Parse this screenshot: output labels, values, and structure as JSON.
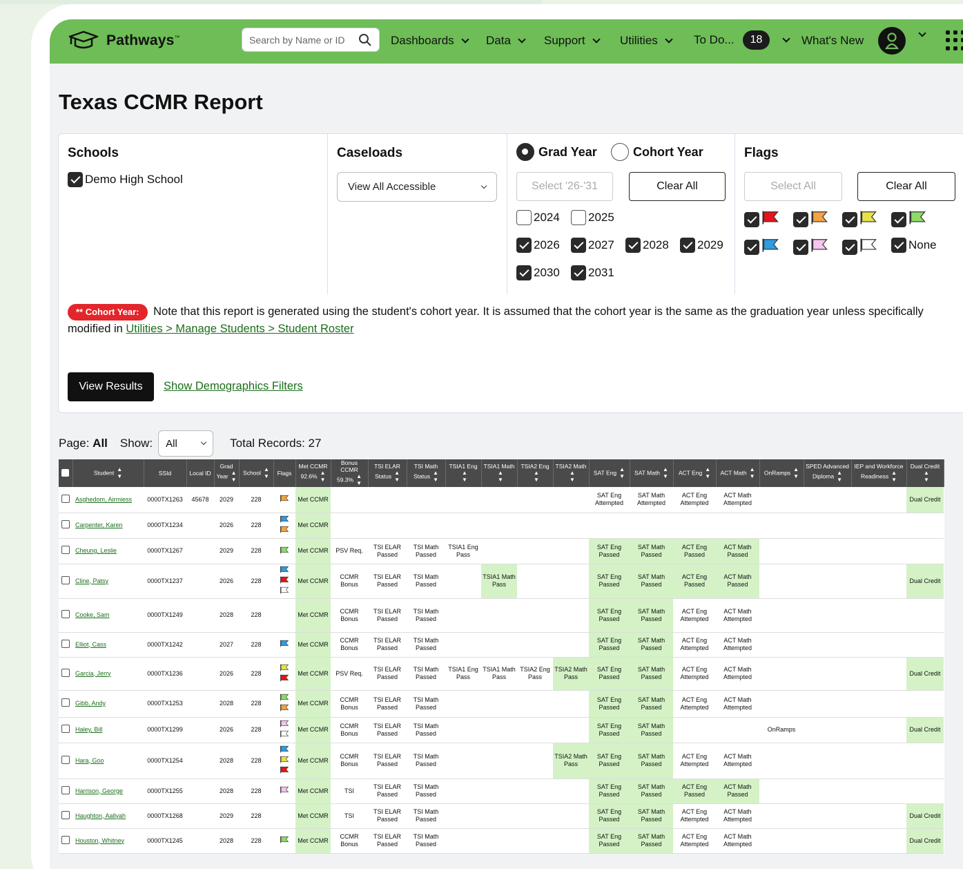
{
  "app": {
    "name": "Pathways",
    "trademark": "™"
  },
  "nav": {
    "search_placeholder": "Search by Name or ID",
    "items": [
      "Dashboards",
      "Data",
      "Support",
      "Utilities"
    ],
    "todo_label": "To Do...",
    "todo_count": "18",
    "whats_new": "What's New"
  },
  "page": {
    "title": "Texas CCMR Report"
  },
  "filters": {
    "schools": {
      "title": "Schools",
      "items": [
        {
          "label": "Demo High School",
          "checked": true
        }
      ]
    },
    "caseloads": {
      "title": "Caseloads",
      "selected": "View All Accessible"
    },
    "year": {
      "grad_label": "Grad Year",
      "cohort_label": "Cohort Year",
      "selected": "Grad Year",
      "select_btn": "Select '26-'31",
      "clear_btn": "Clear All",
      "years": [
        {
          "label": "2024",
          "checked": false
        },
        {
          "label": "2025",
          "checked": false
        },
        {
          "label": "2026",
          "checked": true
        },
        {
          "label": "2027",
          "checked": true
        },
        {
          "label": "2028",
          "checked": true
        },
        {
          "label": "2029",
          "checked": true
        },
        {
          "label": "2030",
          "checked": true
        },
        {
          "label": "2031",
          "checked": true
        }
      ]
    },
    "flags": {
      "title": "Flags",
      "select_btn": "Select All",
      "clear_btn": "Clear All",
      "none_label": "None",
      "colors": [
        "#e8141b",
        "#f4a340",
        "#e8e04a",
        "#8edb6a",
        "#2f9be0",
        "#f5c6ee",
        "#ffffff"
      ]
    }
  },
  "note": {
    "pill": "** Cohort Year:",
    "text": "Note that this report is generated using the student's cohort year. It is assumed that the cohort year is the same as the graduation year unless specifically modified in",
    "link": "Utilities > Manage Students > Student Roster"
  },
  "actions": {
    "view_results": "View Results",
    "show_demographics": "Show Demographics Filters"
  },
  "pager": {
    "page_label": "Page:",
    "page_value": "All",
    "show_label": "Show:",
    "show_value": "All",
    "total_label": "Total Records: 27"
  },
  "table": {
    "headers": [
      "Student",
      "SSId",
      "Local ID",
      "Grad Year",
      "School",
      "Flags",
      "Met CCMR 92.6%",
      "Bonus CCMR 59.3%",
      "TSI ELAR Status",
      "TSI Math Status",
      "TSIA1 Eng",
      "TSIA1 Math",
      "TSIA2 Eng",
      "TSIA2 Math",
      "SAT Eng",
      "SAT Math",
      "ACT Eng",
      "ACT Math",
      "OnRamps",
      "SPED Advanced Diploma",
      "IEP and Workforce Readiness",
      "Dual Credit"
    ],
    "rows": [
      {
        "name": "Asghedom, Airmiess",
        "ssid": "0000TX1263",
        "local": "45678",
        "grad": "2029",
        "school": "228",
        "flags": [
          "#f4a340"
        ],
        "met": "Met CCMR",
        "bonus": "",
        "elar": "",
        "math": "",
        "a1e": "",
        "a1m": "",
        "a2e": "",
        "a2m": "",
        "sate": "SAT Eng Attempted",
        "satm": "SAT Math Attempted",
        "acte": "ACT Eng Attempted",
        "actm": "ACT Math Attempted",
        "onr": "",
        "sped": "",
        "iep": "",
        "dual": "Dual Credit",
        "h": 37
      },
      {
        "name": "Carpenter, Karen",
        "ssid": "0000TX1234",
        "local": "",
        "grad": "2026",
        "school": "228",
        "flags": [
          "#2f9be0",
          "#f4a340"
        ],
        "met": "Met CCMR",
        "bonus": "",
        "elar": "",
        "math": "",
        "a1e": "",
        "a1m": "",
        "a2e": "",
        "a2m": "",
        "sate": "",
        "satm": "",
        "acte": "",
        "actm": "",
        "onr": "",
        "sped": "",
        "iep": "",
        "dual": "",
        "h": 37
      },
      {
        "name": "Cheung, Leslie",
        "ssid": "0000TX1267",
        "local": "",
        "grad": "2029",
        "school": "228",
        "flags": [
          "#8edb6a"
        ],
        "met": "Met CCMR",
        "bonus": "PSV Req.",
        "elar": "TSI ELAR Passed",
        "math": "TSI Math Passed",
        "a1e": "TSIA1 Eng Pass",
        "a1m": "",
        "a2e": "",
        "a2m": "",
        "sate": "SAT Eng Passed",
        "satm": "SAT Math Passed",
        "acte": "ACT Eng Passed",
        "actm": "ACT Math Passed",
        "onr": "",
        "sped": "",
        "iep": "",
        "dual": "",
        "h": 37
      },
      {
        "name": "Cline, Patsy",
        "ssid": "0000TX1237",
        "local": "",
        "grad": "2026",
        "school": "228",
        "flags": [
          "#2f9be0",
          "#e8141b",
          "#ffffff"
        ],
        "met": "Met CCMR",
        "bonus": "CCMR Bonus",
        "elar": "TSI ELAR Passed",
        "math": "TSI Math Passed",
        "a1e": "",
        "a1m": "TSIA1 Math Pass",
        "a2e": "",
        "a2m": "",
        "sate": "SAT Eng Passed",
        "satm": "SAT Math Passed",
        "acte": "ACT Eng Passed",
        "actm": "ACT Math Passed",
        "onr": "",
        "sped": "",
        "iep": "",
        "dual": "Dual Credit",
        "h": 50
      },
      {
        "name": "Cooke, Sam",
        "ssid": "0000TX1249",
        "local": "",
        "grad": "2028",
        "school": "228",
        "flags": [],
        "met": "Met CCMR",
        "bonus": "CCMR Bonus",
        "elar": "TSI ELAR Passed",
        "math": "TSI Math Passed",
        "a1e": "",
        "a1m": "",
        "a2e": "",
        "a2m": "",
        "sate": "SAT Eng Passed",
        "satm": "SAT Math Passed",
        "acte": "ACT Eng Attempted",
        "actm": "ACT Math Attempted",
        "onr": "",
        "sped": "",
        "iep": "",
        "dual": "",
        "h": 49
      },
      {
        "name": "Elliot, Cass",
        "ssid": "0000TX1242",
        "local": "",
        "grad": "2027",
        "school": "228",
        "flags": [
          "#2f9be0"
        ],
        "met": "Met CCMR",
        "bonus": "CCMR Bonus",
        "elar": "TSI ELAR Passed",
        "math": "TSI Math Passed",
        "a1e": "",
        "a1m": "",
        "a2e": "",
        "a2m": "",
        "sate": "SAT Eng Passed",
        "satm": "SAT Math Passed",
        "acte": "ACT Eng Attempted",
        "actm": "ACT Math Attempted",
        "onr": "",
        "sped": "",
        "iep": "",
        "dual": "",
        "h": 36
      },
      {
        "name": "Garcia, Jerry",
        "ssid": "0000TX1236",
        "local": "",
        "grad": "2026",
        "school": "228",
        "flags": [
          "#e8e04a",
          "#e8141b"
        ],
        "met": "Met CCMR",
        "bonus": "PSV Req.",
        "elar": "TSI ELAR Passed",
        "math": "TSI Math Passed",
        "a1e": "TSIA1 Eng Pass",
        "a1m": "TSIA1 Math Pass",
        "a2e": "TSIA2 Eng Pass",
        "a2m": "TSIA2 Math Pass",
        "sate": "SAT Eng Passed",
        "satm": "SAT Math Passed",
        "acte": "ACT Eng Attempted",
        "actm": "ACT Math Attempted",
        "onr": "",
        "sped": "",
        "iep": "",
        "dual": "Dual Credit",
        "h": 48
      },
      {
        "name": "Gibb, Andy",
        "ssid": "0000TX1253",
        "local": "",
        "grad": "2028",
        "school": "228",
        "flags": [
          "#8edb6a",
          "#f4a340"
        ],
        "met": "Met CCMR",
        "bonus": "CCMR Bonus",
        "elar": "TSI ELAR Passed",
        "math": "TSI Math Passed",
        "a1e": "",
        "a1m": "",
        "a2e": "",
        "a2m": "",
        "sate": "SAT Eng Passed",
        "satm": "SAT Math Passed",
        "acte": "ACT Eng Attempted",
        "actm": "ACT Math Attempted",
        "onr": "",
        "sped": "",
        "iep": "",
        "dual": "",
        "h": 39
      },
      {
        "name": "Haley, Bill",
        "ssid": "0000TX1299",
        "local": "",
        "grad": "2026",
        "school": "228",
        "flags": [
          "#f5c6ee",
          "#ffffff"
        ],
        "met": "Met CCMR",
        "bonus": "CCMR Bonus",
        "elar": "TSI ELAR Passed",
        "math": "TSI Math Passed",
        "a1e": "",
        "a1m": "",
        "a2e": "",
        "a2m": "",
        "sate": "SAT Eng Passed",
        "satm": "SAT Math Passed",
        "acte": "",
        "actm": "",
        "onr": "OnRamps",
        "sped": "",
        "iep": "",
        "dual": "Dual Credit",
        "h": 37
      },
      {
        "name": "Hara, Goo",
        "ssid": "0000TX1254",
        "local": "",
        "grad": "2028",
        "school": "228",
        "flags": [
          "#2f9be0",
          "#e8e04a",
          "#e8141b"
        ],
        "met": "Met CCMR",
        "bonus": "CCMR Bonus",
        "elar": "TSI ELAR Passed",
        "math": "TSI Math Passed",
        "a1e": "",
        "a1m": "",
        "a2e": "",
        "a2m": "TSIA2 Math Pass",
        "sate": "SAT Eng Passed",
        "satm": "SAT Math Passed",
        "acte": "ACT Eng Attempted",
        "actm": "ACT Math Attempted",
        "onr": "",
        "sped": "",
        "iep": "",
        "dual": "",
        "h": 52
      },
      {
        "name": "Harrison, George",
        "ssid": "0000TX1255",
        "local": "",
        "grad": "2028",
        "school": "228",
        "flags": [
          "#f5c6ee"
        ],
        "met": "Met CCMR",
        "bonus": "TSI",
        "elar": "TSI ELAR Passed",
        "math": "TSI Math Passed",
        "a1e": "",
        "a1m": "",
        "a2e": "",
        "a2m": "",
        "sate": "SAT Eng Passed",
        "satm": "SAT Math Passed",
        "acte": "ACT Eng Passed",
        "actm": "ACT Math Passed",
        "onr": "",
        "sped": "",
        "iep": "",
        "dual": "",
        "h": 36
      },
      {
        "name": "Haughton, Aallyah",
        "ssid": "0000TX1268",
        "local": "",
        "grad": "2029",
        "school": "228",
        "flags": [],
        "met": "Met CCMR",
        "bonus": "TSI",
        "elar": "TSI ELAR Passed",
        "math": "TSI Math Passed",
        "a1e": "",
        "a1m": "",
        "a2e": "",
        "a2m": "",
        "sate": "SAT Eng Passed",
        "satm": "SAT Math Passed",
        "acte": "ACT Eng Attempted",
        "actm": "ACT Math Attempted",
        "onr": "",
        "sped": "",
        "iep": "",
        "dual": "Dual Credit",
        "h": 36
      },
      {
        "name": "Houston, Whitney",
        "ssid": "0000TX1245",
        "local": "",
        "grad": "2028",
        "school": "228",
        "flags": [
          "#8edb6a"
        ],
        "met": "Met CCMR",
        "bonus": "CCMR Bonus",
        "elar": "TSI ELAR Passed",
        "math": "TSI Math Passed",
        "a1e": "",
        "a1m": "",
        "a2e": "",
        "a2m": "",
        "sate": "SAT Eng Passed",
        "satm": "SAT Math Passed",
        "acte": "ACT Eng Attempted",
        "actm": "ACT Math Attempted",
        "onr": "",
        "sped": "",
        "iep": "",
        "dual": "Dual Credit",
        "h": 36
      }
    ]
  }
}
